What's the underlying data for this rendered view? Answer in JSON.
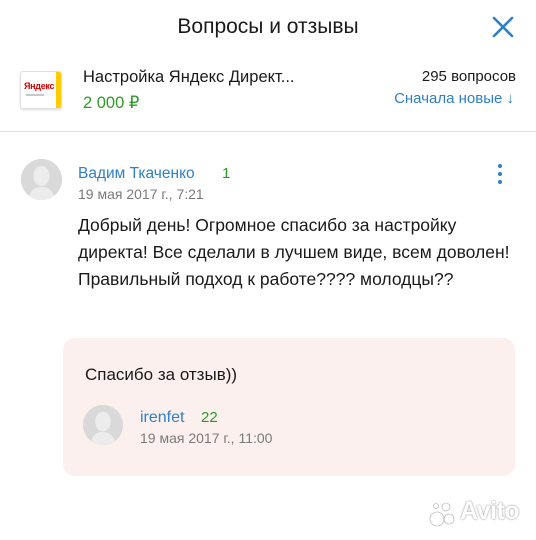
{
  "header": {
    "title": "Вопросы и отзывы",
    "close_icon": "close-icon"
  },
  "product": {
    "thumbnail_logo": "Яндекс",
    "name": "Настройка Яндекс Директ...",
    "price": "2 000 ₽",
    "question_count": "295 вопросов",
    "sort_label": "Сначала новые ↓"
  },
  "review": {
    "author": {
      "name": "Вадим Ткаченко",
      "rating": "1",
      "date": "19 мая 2017 г., 7:21"
    },
    "text": "Добрый день! Огромное спасибо за настройку директа!  Все сделали в лучшем виде, всем доволен! Правильный подход к работе???? молодцы??",
    "reply": {
      "text": "Спасибо за отзыв))",
      "seller": {
        "name": "irenfet",
        "rating": "22",
        "date": "19 мая 2017 г., 11:00"
      }
    }
  },
  "watermark": {
    "text": "Avito"
  },
  "colors": {
    "link": "#2f80c7",
    "price_green": "#2e9b27",
    "reply_background": "#fcf0ee",
    "meta_gray": "#7a7a7a"
  }
}
